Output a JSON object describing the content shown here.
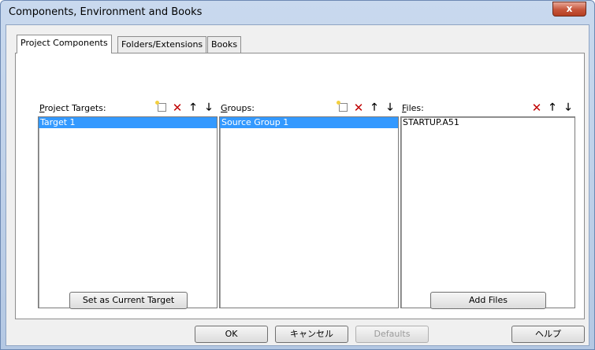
{
  "window": {
    "title": "Components, Environment and Books",
    "close_label": "x"
  },
  "tabs": [
    {
      "label": "Project Components",
      "active": true
    },
    {
      "label": "Folders/Extensions",
      "active": false
    },
    {
      "label": "Books",
      "active": false
    }
  ],
  "targets": {
    "label_key": "P",
    "label_rest": "roject Targets:",
    "items": [
      {
        "label": "Target 1",
        "selected": true
      }
    ],
    "icons": [
      "new-icon",
      "delete-icon",
      "move-up-icon",
      "move-down-icon"
    ]
  },
  "groups": {
    "label_key": "G",
    "label_rest": "roups:",
    "items": [
      {
        "label": "Source Group 1",
        "selected": true
      }
    ],
    "icons": [
      "new-icon",
      "delete-icon",
      "move-up-icon",
      "move-down-icon"
    ]
  },
  "files": {
    "label_key": "F",
    "label_rest": "iles:",
    "items": [
      {
        "label": "STARTUP.A51",
        "selected": false
      }
    ],
    "icons": [
      "delete-icon",
      "move-up-icon",
      "move-down-icon"
    ]
  },
  "glyphs": {
    "delete": "✕",
    "up": "🡑",
    "down": "🡓"
  },
  "buttons": {
    "set_current_target": "Set as Current Target",
    "add_files": "Add Files",
    "ok": "OK",
    "cancel": "キャンセル",
    "defaults": "Defaults",
    "help": "ヘルプ"
  }
}
